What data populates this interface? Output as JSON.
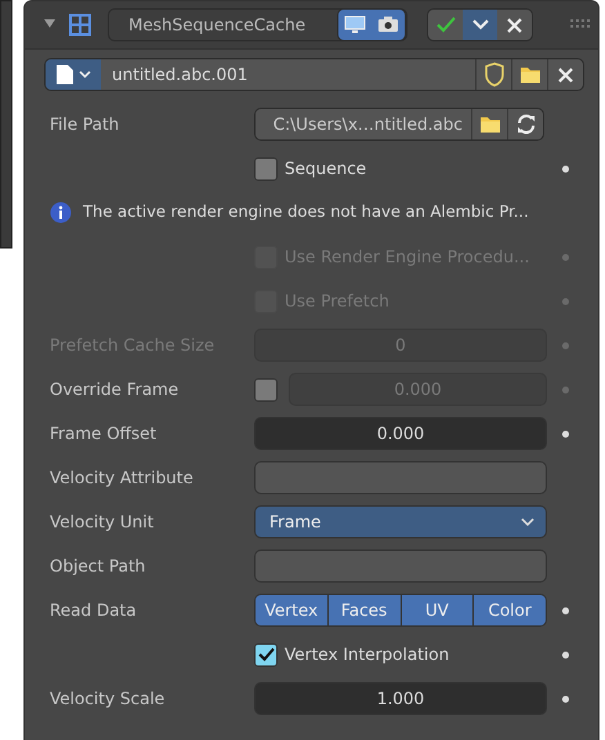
{
  "header": {
    "expanded": true,
    "name": "MeshSequenceCache",
    "toggles": [
      {
        "kind": "viewport",
        "on": true
      },
      {
        "kind": "render",
        "on": true
      }
    ],
    "actions": [
      {
        "kind": "apply",
        "selected": false
      },
      {
        "kind": "menu",
        "selected": true
      },
      {
        "kind": "remove",
        "selected": false
      }
    ]
  },
  "cache_file": {
    "name": "untitled.abc.001"
  },
  "rows": [
    {
      "kind": "path",
      "label": "File Path",
      "value": "C:\\Users\\x…ntitled.abc"
    },
    {
      "kind": "checkbox",
      "text": "Sequence",
      "checked": false,
      "disabled": false
    },
    {
      "kind": "info",
      "text": "The active render engine does not have an Alembic Pr..."
    },
    {
      "kind": "checkbox",
      "text": "Use Render Engine Procedu...",
      "checked": false,
      "disabled": true
    },
    {
      "kind": "checkbox",
      "text": "Use Prefetch",
      "checked": false,
      "disabled": true
    },
    {
      "kind": "number",
      "label": "Prefetch Cache Size",
      "value": "0",
      "disabled": true
    },
    {
      "kind": "toggle_number",
      "label": "Override Frame",
      "value": "0.000",
      "checked": false,
      "disabled": false
    },
    {
      "kind": "number",
      "label": "Frame Offset",
      "value": "0.000",
      "disabled": false
    },
    {
      "kind": "text",
      "label": "Velocity Attribute"
    },
    {
      "kind": "select",
      "label": "Velocity Unit",
      "value": "Frame"
    },
    {
      "kind": "text",
      "label": "Object Path"
    },
    {
      "kind": "multi",
      "label": "Read Data",
      "options": [
        {
          "label": "Vertex",
          "selected": true
        },
        {
          "label": "Faces",
          "selected": true
        },
        {
          "label": "UV",
          "selected": true
        },
        {
          "label": "Color",
          "selected": true
        }
      ]
    },
    {
      "kind": "checkbox",
      "text": "Vertex Interpolation",
      "checked": true,
      "disabled": false
    },
    {
      "kind": "number",
      "label": "Velocity Scale",
      "value": "1.000",
      "disabled": false
    }
  ]
}
